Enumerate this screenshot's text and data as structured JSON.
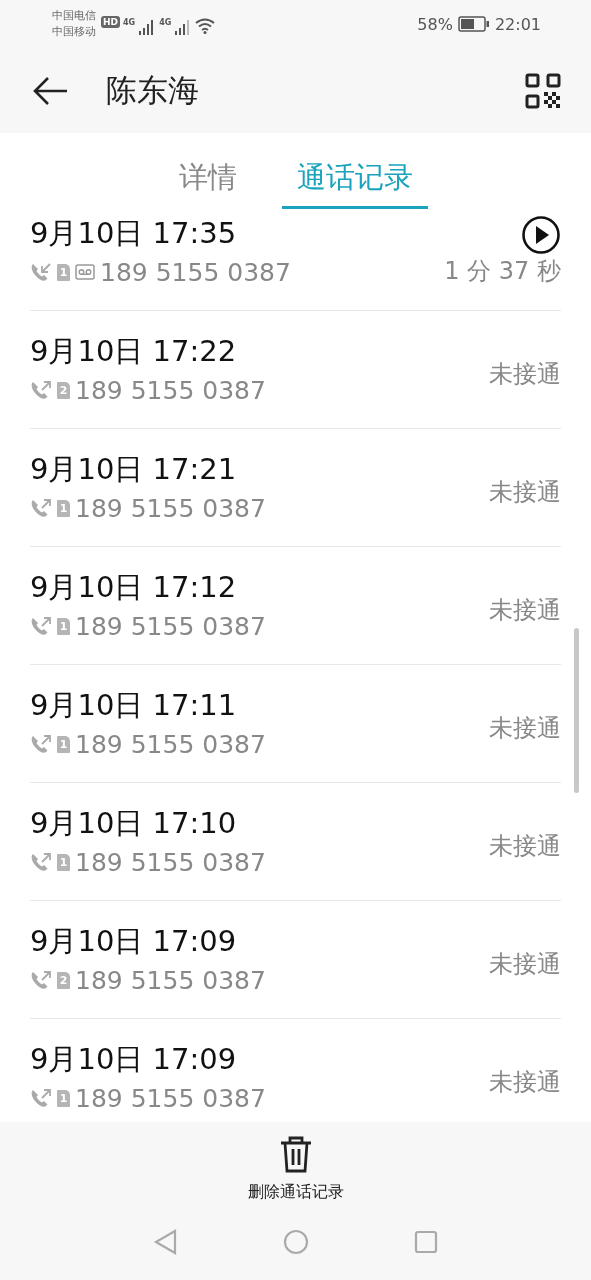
{
  "status_bar": {
    "carrier_1": "中国电信",
    "hd_badge": "HD",
    "network_1": "4G",
    "network_2": "4G",
    "carrier_2": "中国移动",
    "battery_percent": "58%",
    "time": "22:01"
  },
  "header": {
    "title": "陈东海"
  },
  "tabs": [
    {
      "label": "详情",
      "selected": false
    },
    {
      "label": "通话记录",
      "selected": true
    }
  ],
  "calls": [
    {
      "datetime": "9月10日 17:35",
      "kind": "incoming",
      "sim": "1",
      "voicemail": true,
      "number": "189 5155 0387",
      "result": "1 分 37 秒",
      "playable": true
    },
    {
      "datetime": "9月10日 17:22",
      "kind": "outgoing",
      "sim": "2",
      "number": "189 5155 0387",
      "result": "未接通"
    },
    {
      "datetime": "9月10日 17:21",
      "kind": "outgoing",
      "sim": "1",
      "number": "189 5155 0387",
      "result": "未接通"
    },
    {
      "datetime": "9月10日 17:12",
      "kind": "outgoing",
      "sim": "1",
      "number": "189 5155 0387",
      "result": "未接通"
    },
    {
      "datetime": "9月10日 17:11",
      "kind": "outgoing",
      "sim": "1",
      "number": "189 5155 0387",
      "result": "未接通"
    },
    {
      "datetime": "9月10日 17:10",
      "kind": "outgoing",
      "sim": "1",
      "number": "189 5155 0387",
      "result": "未接通"
    },
    {
      "datetime": "9月10日 17:09",
      "kind": "outgoing",
      "sim": "2",
      "number": "189 5155 0387",
      "result": "未接通"
    },
    {
      "datetime": "9月10日 17:09",
      "kind": "outgoing",
      "sim": "1",
      "number": "189 5155 0387",
      "result": "未接通"
    }
  ],
  "bottom_action": {
    "label": "删除通话记录"
  }
}
